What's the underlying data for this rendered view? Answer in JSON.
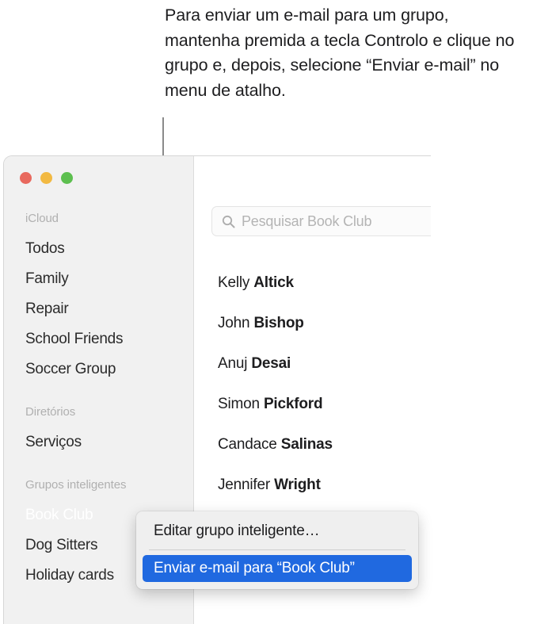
{
  "caption": "Para enviar um e-mail para um grupo, mantenha premida a tecla Controlo e clique no grupo e, depois, selecione “Enviar e-mail” no menu de atalho.",
  "colors": {
    "accent_blue": "#2069e0",
    "selection_gray": "#d9d9d9",
    "sidebar_bg": "#f1f1f1",
    "traffic_red": "#e8695e",
    "traffic_yellow": "#f2b942",
    "traffic_green": "#5dbf4f"
  },
  "window": {
    "traffic_lights": [
      {
        "name": "close",
        "color": "#e8695e"
      },
      {
        "name": "minimize",
        "color": "#f2b942"
      },
      {
        "name": "zoom",
        "color": "#5dbf4f"
      }
    ]
  },
  "sidebar": {
    "sections": [
      {
        "header": "iCloud",
        "items": [
          {
            "label": "Todos",
            "selected": false
          },
          {
            "label": "Family",
            "selected": false
          },
          {
            "label": "Repair",
            "selected": false
          },
          {
            "label": "School Friends",
            "selected": false
          },
          {
            "label": "Soccer Group",
            "selected": false
          }
        ]
      },
      {
        "header": "Diretórios",
        "items": [
          {
            "label": "Serviços",
            "selected": false
          }
        ]
      },
      {
        "header": "Grupos inteligentes",
        "items": [
          {
            "label": "Book Club",
            "selected": true
          },
          {
            "label": "Dog Sitters",
            "selected": false
          },
          {
            "label": "Holiday cards",
            "selected": false
          }
        ]
      }
    ]
  },
  "search": {
    "placeholder": "Pesquisar Book Club",
    "value": "",
    "icon": "search-icon"
  },
  "contacts": [
    {
      "first": "Kelly",
      "last": "Altick",
      "selected": true
    },
    {
      "first": "John",
      "last": "Bishop",
      "selected": false
    },
    {
      "first": "Anuj",
      "last": "Desai",
      "selected": false
    },
    {
      "first": "Simon",
      "last": "Pickford",
      "selected": false
    },
    {
      "first": "Candace",
      "last": "Salinas",
      "selected": false
    },
    {
      "first": "Jennifer",
      "last": "Wright",
      "selected": false
    }
  ],
  "context_menu": {
    "items": [
      {
        "label": "Editar grupo inteligente…",
        "highlighted": false
      },
      {
        "label": "Enviar e-mail para “Book Club”",
        "highlighted": true
      }
    ]
  }
}
